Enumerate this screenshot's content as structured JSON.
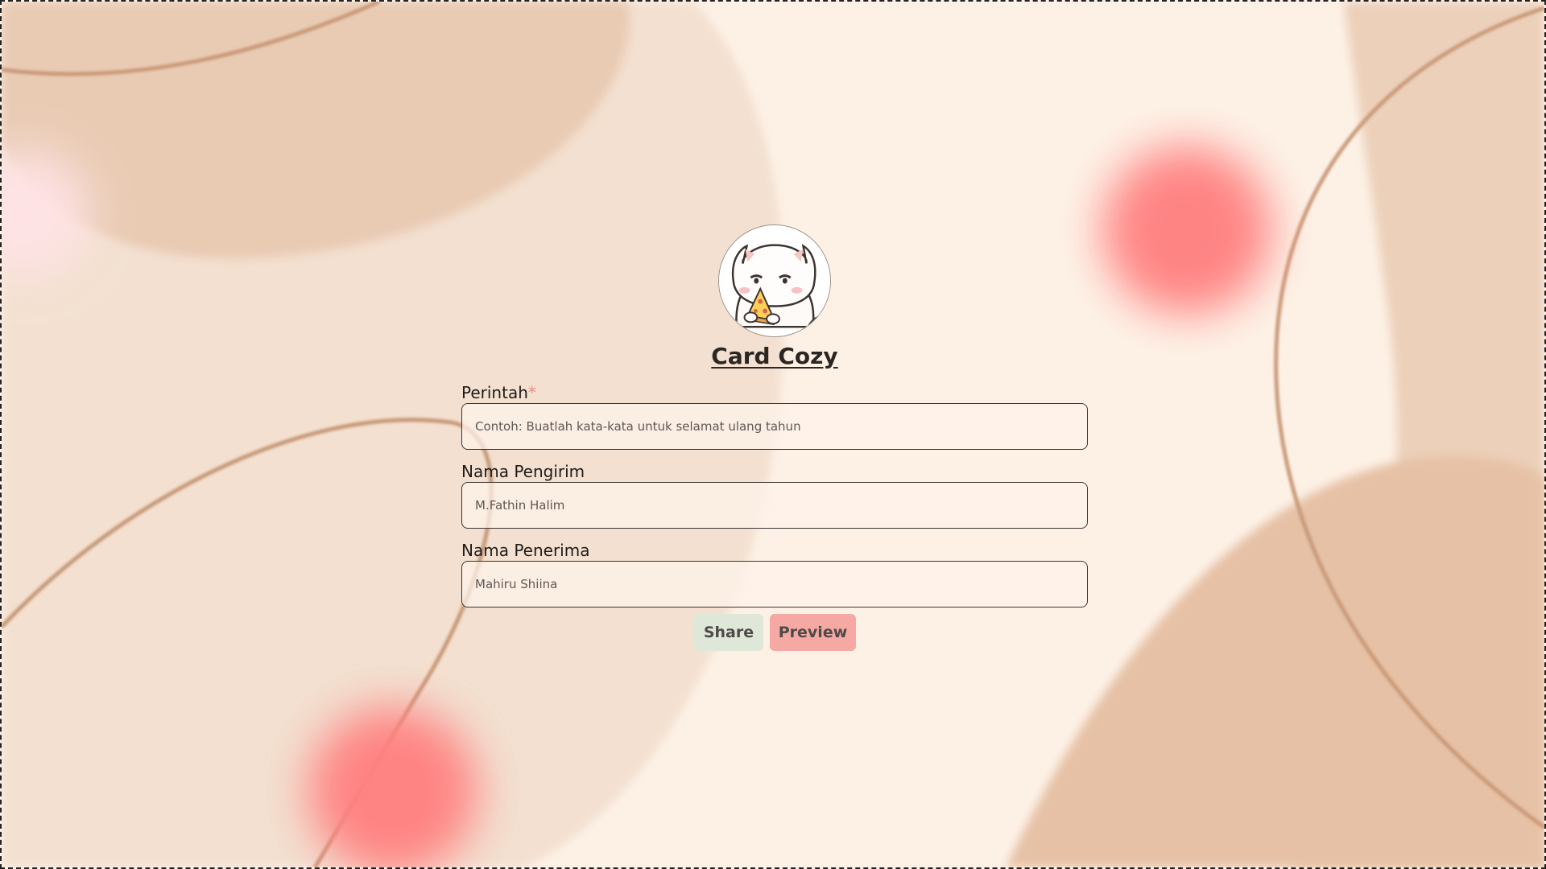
{
  "colors": {
    "background": "#fdf1e6",
    "share_button": "#dfe8d8",
    "preview_button": "#f6a8a2",
    "required_marker": "#f08a84",
    "blob": "#ff8080"
  },
  "header": {
    "avatar_icon": "cat-eating-pizza-icon",
    "title": "Card Cozy"
  },
  "form": {
    "perintah": {
      "label": "Perintah",
      "required_mark": "*",
      "placeholder": "Contoh: Buatlah kata-kata untuk selamat ulang tahun",
      "value": ""
    },
    "pengirim": {
      "label": "Nama Pengirim",
      "placeholder": "M.Fathin Halim",
      "value": ""
    },
    "penerima": {
      "label": "Nama Penerima",
      "placeholder": "Mahiru Shiina",
      "value": ""
    }
  },
  "actions": {
    "share_label": "Share",
    "preview_label": "Preview"
  }
}
